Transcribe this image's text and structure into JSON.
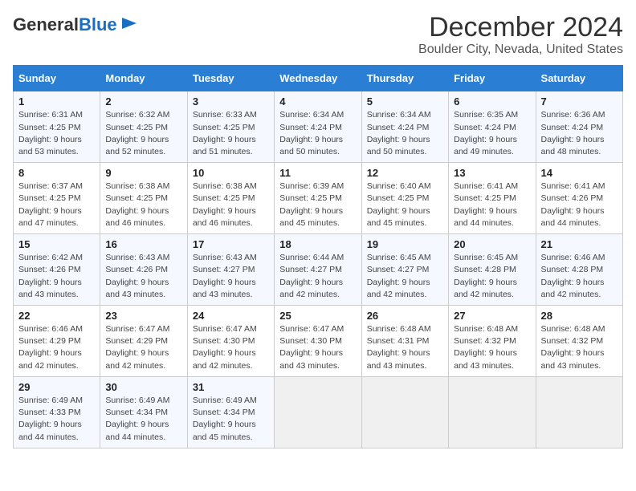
{
  "logo": {
    "general": "General",
    "blue": "Blue"
  },
  "header": {
    "month": "December 2024",
    "location": "Boulder City, Nevada, United States"
  },
  "days_of_week": [
    "Sunday",
    "Monday",
    "Tuesday",
    "Wednesday",
    "Thursday",
    "Friday",
    "Saturday"
  ],
  "weeks": [
    [
      {
        "day": "1",
        "sunrise": "6:31 AM",
        "sunset": "4:25 PM",
        "daylight": "9 hours and 53 minutes."
      },
      {
        "day": "2",
        "sunrise": "6:32 AM",
        "sunset": "4:25 PM",
        "daylight": "9 hours and 52 minutes."
      },
      {
        "day": "3",
        "sunrise": "6:33 AM",
        "sunset": "4:25 PM",
        "daylight": "9 hours and 51 minutes."
      },
      {
        "day": "4",
        "sunrise": "6:34 AM",
        "sunset": "4:24 PM",
        "daylight": "9 hours and 50 minutes."
      },
      {
        "day": "5",
        "sunrise": "6:34 AM",
        "sunset": "4:24 PM",
        "daylight": "9 hours and 50 minutes."
      },
      {
        "day": "6",
        "sunrise": "6:35 AM",
        "sunset": "4:24 PM",
        "daylight": "9 hours and 49 minutes."
      },
      {
        "day": "7",
        "sunrise": "6:36 AM",
        "sunset": "4:24 PM",
        "daylight": "9 hours and 48 minutes."
      }
    ],
    [
      {
        "day": "8",
        "sunrise": "6:37 AM",
        "sunset": "4:25 PM",
        "daylight": "9 hours and 47 minutes."
      },
      {
        "day": "9",
        "sunrise": "6:38 AM",
        "sunset": "4:25 PM",
        "daylight": "9 hours and 46 minutes."
      },
      {
        "day": "10",
        "sunrise": "6:38 AM",
        "sunset": "4:25 PM",
        "daylight": "9 hours and 46 minutes."
      },
      {
        "day": "11",
        "sunrise": "6:39 AM",
        "sunset": "4:25 PM",
        "daylight": "9 hours and 45 minutes."
      },
      {
        "day": "12",
        "sunrise": "6:40 AM",
        "sunset": "4:25 PM",
        "daylight": "9 hours and 45 minutes."
      },
      {
        "day": "13",
        "sunrise": "6:41 AM",
        "sunset": "4:25 PM",
        "daylight": "9 hours and 44 minutes."
      },
      {
        "day": "14",
        "sunrise": "6:41 AM",
        "sunset": "4:26 PM",
        "daylight": "9 hours and 44 minutes."
      }
    ],
    [
      {
        "day": "15",
        "sunrise": "6:42 AM",
        "sunset": "4:26 PM",
        "daylight": "9 hours and 43 minutes."
      },
      {
        "day": "16",
        "sunrise": "6:43 AM",
        "sunset": "4:26 PM",
        "daylight": "9 hours and 43 minutes."
      },
      {
        "day": "17",
        "sunrise": "6:43 AM",
        "sunset": "4:27 PM",
        "daylight": "9 hours and 43 minutes."
      },
      {
        "day": "18",
        "sunrise": "6:44 AM",
        "sunset": "4:27 PM",
        "daylight": "9 hours and 42 minutes."
      },
      {
        "day": "19",
        "sunrise": "6:45 AM",
        "sunset": "4:27 PM",
        "daylight": "9 hours and 42 minutes."
      },
      {
        "day": "20",
        "sunrise": "6:45 AM",
        "sunset": "4:28 PM",
        "daylight": "9 hours and 42 minutes."
      },
      {
        "day": "21",
        "sunrise": "6:46 AM",
        "sunset": "4:28 PM",
        "daylight": "9 hours and 42 minutes."
      }
    ],
    [
      {
        "day": "22",
        "sunrise": "6:46 AM",
        "sunset": "4:29 PM",
        "daylight": "9 hours and 42 minutes."
      },
      {
        "day": "23",
        "sunrise": "6:47 AM",
        "sunset": "4:29 PM",
        "daylight": "9 hours and 42 minutes."
      },
      {
        "day": "24",
        "sunrise": "6:47 AM",
        "sunset": "4:30 PM",
        "daylight": "9 hours and 42 minutes."
      },
      {
        "day": "25",
        "sunrise": "6:47 AM",
        "sunset": "4:30 PM",
        "daylight": "9 hours and 43 minutes."
      },
      {
        "day": "26",
        "sunrise": "6:48 AM",
        "sunset": "4:31 PM",
        "daylight": "9 hours and 43 minutes."
      },
      {
        "day": "27",
        "sunrise": "6:48 AM",
        "sunset": "4:32 PM",
        "daylight": "9 hours and 43 minutes."
      },
      {
        "day": "28",
        "sunrise": "6:48 AM",
        "sunset": "4:32 PM",
        "daylight": "9 hours and 43 minutes."
      }
    ],
    [
      {
        "day": "29",
        "sunrise": "6:49 AM",
        "sunset": "4:33 PM",
        "daylight": "9 hours and 44 minutes."
      },
      {
        "day": "30",
        "sunrise": "6:49 AM",
        "sunset": "4:34 PM",
        "daylight": "9 hours and 44 minutes."
      },
      {
        "day": "31",
        "sunrise": "6:49 AM",
        "sunset": "4:34 PM",
        "daylight": "9 hours and 45 minutes."
      },
      null,
      null,
      null,
      null
    ]
  ]
}
